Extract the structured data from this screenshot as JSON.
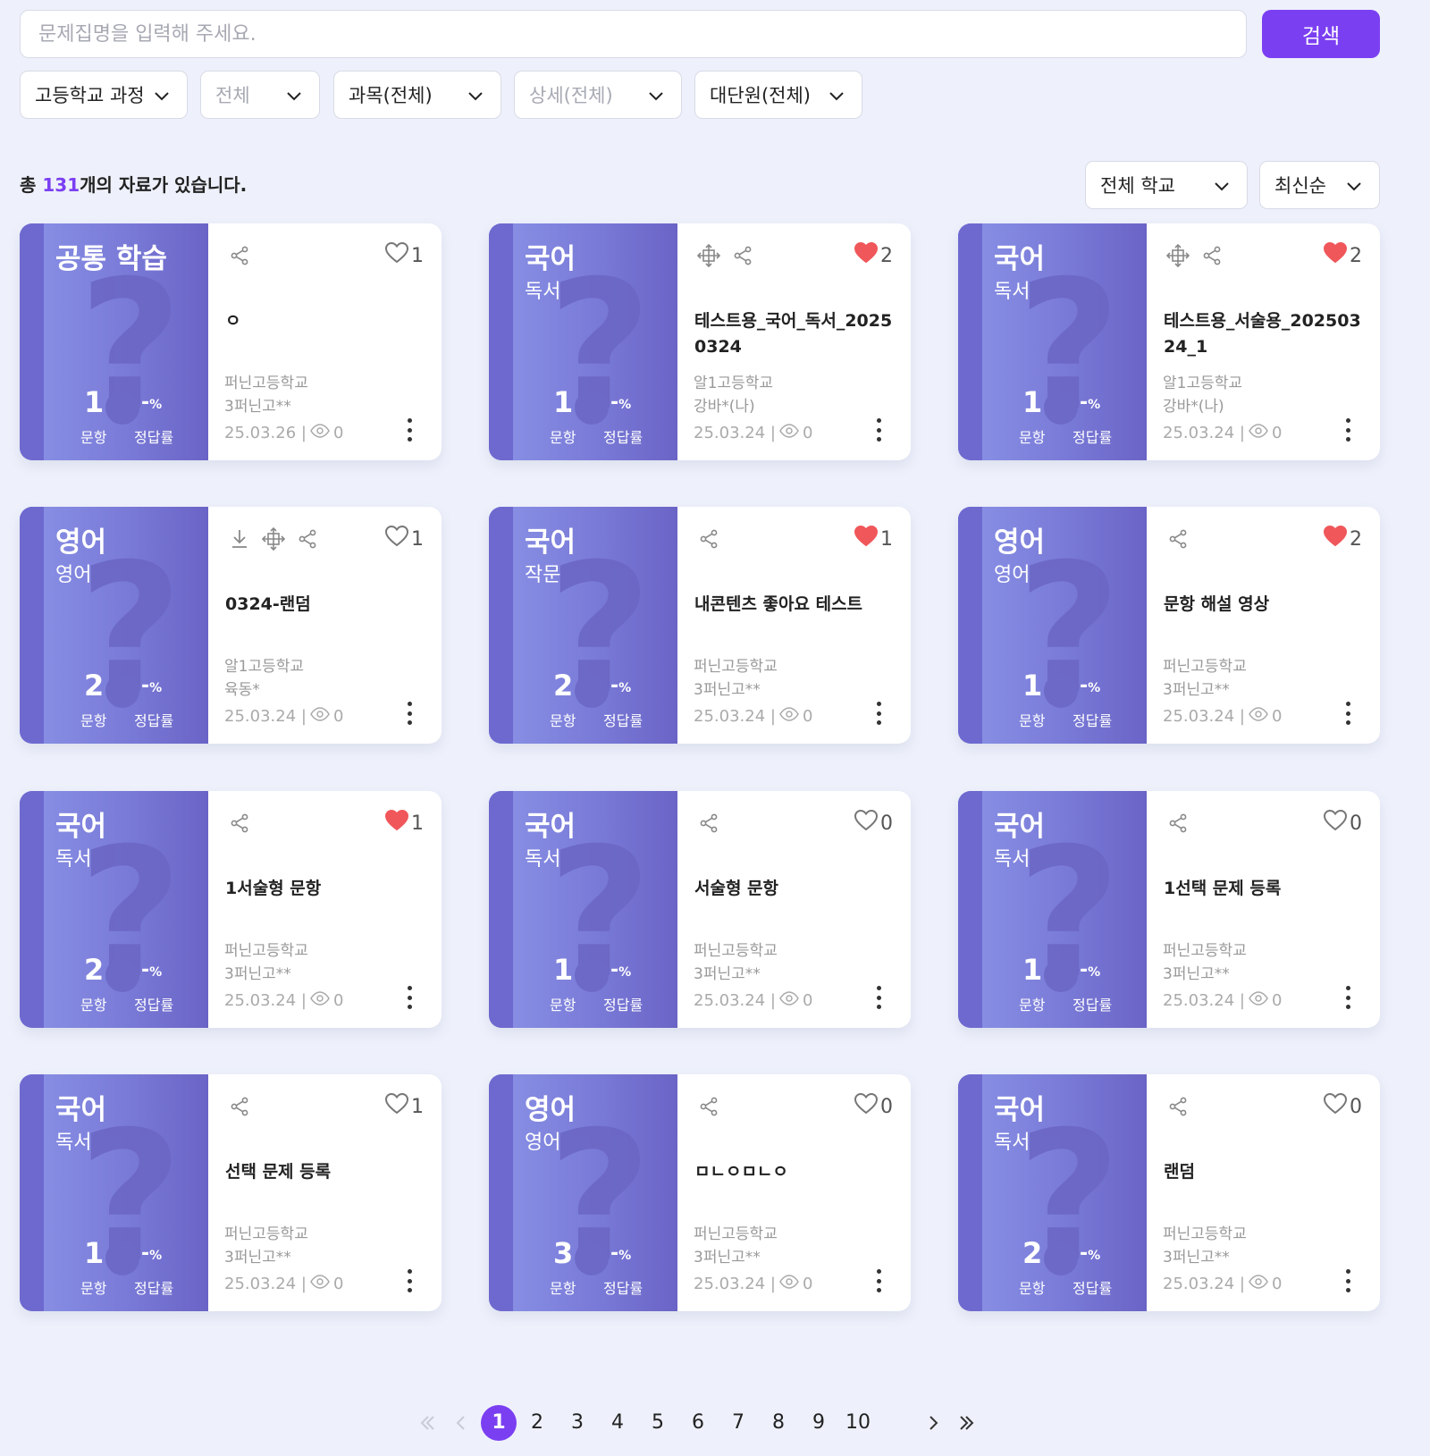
{
  "search": {
    "placeholder": "문제집명을 입력해 주세요.",
    "button_label": "검색"
  },
  "filters": [
    {
      "label": "고등학교 과정",
      "muted": false
    },
    {
      "label": "전체",
      "muted": true
    },
    {
      "label": "과목(전체)",
      "muted": false
    },
    {
      "label": "상세(전체)",
      "muted": true
    },
    {
      "label": "대단원(전체)",
      "muted": false
    }
  ],
  "summary": {
    "prefix": "총 ",
    "count": "131",
    "suffix": "개의 자료가 있습니다."
  },
  "sort": {
    "school_filter": "전체 학교",
    "order": "최신순"
  },
  "labels": {
    "questions": "문항",
    "correct_rate": "정답률",
    "rate_value": "-",
    "rate_unit": "%"
  },
  "colors": {
    "accent": "#7b3ff2",
    "heart_filled": "#f0575a",
    "cover": "#7a7bd8"
  },
  "cards": [
    {
      "subject": "공통 학습",
      "detail": "",
      "qcount": "1",
      "title": "ㅇ",
      "school": "퍼닌고등학교",
      "author": "3퍼닌고**",
      "date": "25.03.26",
      "views": "0",
      "likes": "1",
      "liked": false,
      "icons": [
        "share-icon"
      ]
    },
    {
      "subject": "국어",
      "detail": "독서",
      "qcount": "1",
      "title": "테스트용_국어_독서_20250324",
      "school": "알1고등학교",
      "author": "강바*(나)",
      "date": "25.03.24",
      "views": "0",
      "likes": "2",
      "liked": true,
      "icons": [
        "move-icon",
        "share-icon"
      ]
    },
    {
      "subject": "국어",
      "detail": "독서",
      "qcount": "1",
      "title": "테스트용_서술용_20250324_1",
      "school": "알1고등학교",
      "author": "강바*(나)",
      "date": "25.03.24",
      "views": "0",
      "likes": "2",
      "liked": true,
      "icons": [
        "move-icon",
        "share-icon"
      ]
    },
    {
      "subject": "영어",
      "detail": "영어",
      "qcount": "2",
      "title": "0324-랜덤",
      "school": "알1고등학교",
      "author": "육동*",
      "date": "25.03.24",
      "views": "0",
      "likes": "1",
      "liked": false,
      "icons": [
        "download-icon",
        "move-icon",
        "share-icon"
      ]
    },
    {
      "subject": "국어",
      "detail": "작문",
      "qcount": "2",
      "title": "내콘텐츠 좋아요 테스트",
      "school": "퍼닌고등학교",
      "author": "3퍼닌고**",
      "date": "25.03.24",
      "views": "0",
      "likes": "1",
      "liked": true,
      "icons": [
        "share-icon"
      ]
    },
    {
      "subject": "영어",
      "detail": "영어",
      "qcount": "1",
      "title": "문항 해설 영상",
      "school": "퍼닌고등학교",
      "author": "3퍼닌고**",
      "date": "25.03.24",
      "views": "0",
      "likes": "2",
      "liked": true,
      "icons": [
        "share-icon"
      ]
    },
    {
      "subject": "국어",
      "detail": "독서",
      "qcount": "2",
      "title": "1서술형 문항",
      "school": "퍼닌고등학교",
      "author": "3퍼닌고**",
      "date": "25.03.24",
      "views": "0",
      "likes": "1",
      "liked": true,
      "icons": [
        "share-icon"
      ]
    },
    {
      "subject": "국어",
      "detail": "독서",
      "qcount": "1",
      "title": "서술형 문항",
      "school": "퍼닌고등학교",
      "author": "3퍼닌고**",
      "date": "25.03.24",
      "views": "0",
      "likes": "0",
      "liked": false,
      "icons": [
        "share-icon"
      ]
    },
    {
      "subject": "국어",
      "detail": "독서",
      "qcount": "1",
      "title": "1선택 문제 등록",
      "school": "퍼닌고등학교",
      "author": "3퍼닌고**",
      "date": "25.03.24",
      "views": "0",
      "likes": "0",
      "liked": false,
      "icons": [
        "share-icon"
      ]
    },
    {
      "subject": "국어",
      "detail": "독서",
      "qcount": "1",
      "title": "선택 문제 등록",
      "school": "퍼닌고등학교",
      "author": "3퍼닌고**",
      "date": "25.03.24",
      "views": "0",
      "likes": "1",
      "liked": false,
      "icons": [
        "share-icon"
      ]
    },
    {
      "subject": "영어",
      "detail": "영어",
      "qcount": "3",
      "title": "ㅁㄴㅇㅁㄴㅇ",
      "school": "퍼닌고등학교",
      "author": "3퍼닌고**",
      "date": "25.03.24",
      "views": "0",
      "likes": "0",
      "liked": false,
      "icons": [
        "share-icon"
      ]
    },
    {
      "subject": "국어",
      "detail": "독서",
      "qcount": "2",
      "title": "랜덤",
      "school": "퍼닌고등학교",
      "author": "3퍼닌고**",
      "date": "25.03.24",
      "views": "0",
      "likes": "0",
      "liked": false,
      "icons": [
        "share-icon"
      ]
    }
  ],
  "pagination": {
    "pages": [
      "1",
      "2",
      "3",
      "4",
      "5",
      "6",
      "7",
      "8",
      "9",
      "10"
    ],
    "current": "1"
  }
}
